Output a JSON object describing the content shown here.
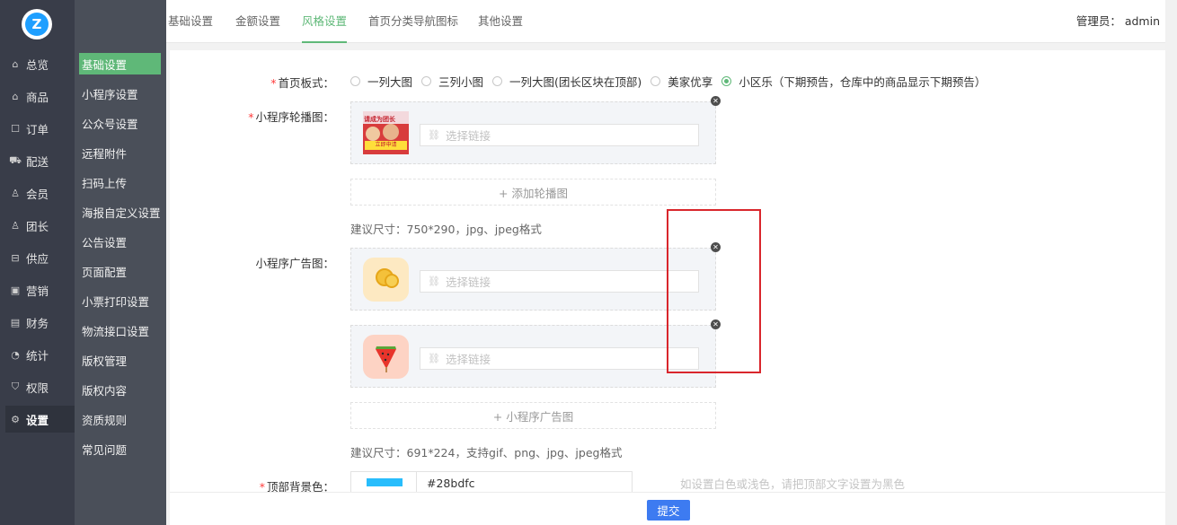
{
  "logo": {
    "letter": "Z"
  },
  "rail": [
    {
      "label": "总览",
      "icon": "home-icon"
    },
    {
      "label": "商品",
      "icon": "goods-icon"
    },
    {
      "label": "订单",
      "icon": "order-icon"
    },
    {
      "label": "配送",
      "icon": "truck-icon"
    },
    {
      "label": "会员",
      "icon": "user-icon"
    },
    {
      "label": "团长",
      "icon": "leader-icon"
    },
    {
      "label": "供应",
      "icon": "supply-icon"
    },
    {
      "label": "营销",
      "icon": "gift-icon"
    },
    {
      "label": "财务",
      "icon": "finance-icon"
    },
    {
      "label": "统计",
      "icon": "chart-icon"
    },
    {
      "label": "权限",
      "icon": "shield-icon"
    },
    {
      "label": "设置",
      "icon": "gear-icon",
      "active": true
    }
  ],
  "submenu": [
    {
      "label": "基础设置",
      "active": true
    },
    {
      "label": "小程序设置"
    },
    {
      "label": "公众号设置"
    },
    {
      "label": "远程附件"
    },
    {
      "label": "扫码上传"
    },
    {
      "label": "海报自定义设置"
    },
    {
      "label": "公告设置"
    },
    {
      "label": "页面配置"
    },
    {
      "label": "小票打印设置"
    },
    {
      "label": "物流接口设置"
    },
    {
      "label": "版权管理"
    },
    {
      "label": "版权内容"
    },
    {
      "label": "资质规则"
    },
    {
      "label": "常见问题"
    }
  ],
  "tabs": [
    {
      "label": "基础设置"
    },
    {
      "label": "金额设置"
    },
    {
      "label": "风格设置",
      "active": true
    },
    {
      "label": "首页分类导航图标"
    },
    {
      "label": "其他设置"
    }
  ],
  "admin": {
    "text": "管理员： admin"
  },
  "form": {
    "layout_label": "首页板式：",
    "layout_options": [
      {
        "label": "一列大图"
      },
      {
        "label": "三列小图"
      },
      {
        "label": "一列大图(团长区块在顶部)"
      },
      {
        "label": "美家优享"
      },
      {
        "label": "小区乐（下期预告，仓库中的商品显示下期预告）",
        "checked": true
      }
    ],
    "carousel_label": "小程序轮播图：",
    "link_placeholder": "选择链接",
    "add_carousel": "+ 添加轮播图",
    "carousel_hint": "建议尺寸：750*290，jpg、jpeg格式",
    "carousel_banner_text": "请成为团长",
    "carousel_banner_btn": "立即申请",
    "ad_label": "小程序广告图：",
    "add_ad": "+ 小程序广告图",
    "ad_hint": "建议尺寸：691*224，支持gif、png、jpg、jpeg格式",
    "topbg_label": "顶部背景色：",
    "topbg_value": "#28bdfc",
    "topbg_hint": "如设置白色或浅色，请把顶部文字设置为黑色"
  },
  "colors": {
    "accent": "#5fb878",
    "swatch": "#28bdfc",
    "submit": "#3d7bf1"
  },
  "submit_label": "提交"
}
